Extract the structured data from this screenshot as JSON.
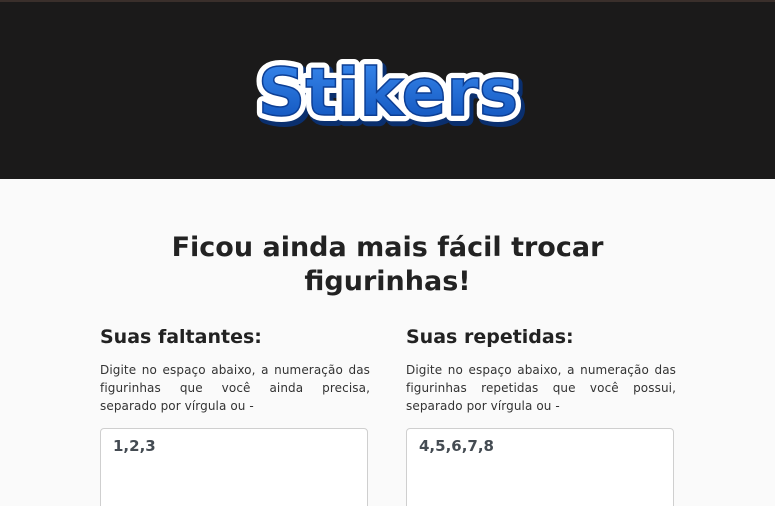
{
  "brand": {
    "logo_text": "Stikers",
    "logo_colors": {
      "fill": "#1c66d4",
      "outline": "#ffffff",
      "shadow": "#0a2f6e"
    },
    "header_bg": "#1b1a1a"
  },
  "headline": {
    "line1": "Ficou ainda mais fácil trocar",
    "line2": "figurinhas!"
  },
  "missing": {
    "title": "Suas faltantes:",
    "description": "Digite no espaço abaixo, a numeração das figurinhas que você ainda precisa, separado por vírgula ou -",
    "value": "1,2,3"
  },
  "duplicates": {
    "title": "Suas repetidas:",
    "description": "Digite no espaço abaixo, a numeração das figurinhas repetidas que você possui, separado por vírgula ou -",
    "value": "4,5,6,7,8"
  }
}
